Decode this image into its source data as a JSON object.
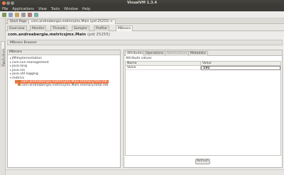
{
  "window": {
    "title": "VisualVM 1.3.4"
  },
  "menu": [
    "File",
    "Applications",
    "View",
    "Tools",
    "Window",
    "Help"
  ],
  "left_strip": {
    "tab_label": "Applications"
  },
  "document_tabs": [
    {
      "label": "Start Page"
    },
    {
      "label": "com.andreabergia.metricsjmx.Main (pid 25255)"
    }
  ],
  "sub_tabs": [
    {
      "label": "Overview"
    },
    {
      "label": "Monitor"
    },
    {
      "label": "Threads"
    },
    {
      "label": "Sampler"
    },
    {
      "label": "Profiler"
    },
    {
      "label": "MBeans"
    }
  ],
  "heading": {
    "main": "com.andreabergia.metricsjmx.Main",
    "pid": "(pid 25255)"
  },
  "section_title": "MBeans Browser",
  "tree": {
    "header": "MBeans",
    "items": [
      {
        "label": "JMImplementation",
        "indent": 0,
        "expander": "▸"
      },
      {
        "label": "com.sun.management",
        "indent": 0,
        "expander": "▸"
      },
      {
        "label": "java.lang",
        "indent": 0,
        "expander": "▸"
      },
      {
        "label": "java.nio",
        "indent": 0,
        "expander": "▸"
      },
      {
        "label": "java.util.logging",
        "indent": 0,
        "expander": "▸"
      },
      {
        "label": "metrics",
        "indent": 0,
        "expander": "▾"
      },
      {
        "label": "com.andreabergia.metricsjmx.Main.memory.free.mb",
        "indent": 1,
        "expander": "",
        "selected": true
      },
      {
        "label": "com.andreabergia.metricsjmx.Main.memory.total.mb",
        "indent": 1,
        "expander": ""
      }
    ]
  },
  "detail_tabs": [
    {
      "label": "Attributes",
      "state": "active"
    },
    {
      "label": "Operations",
      "state": "normal"
    },
    {
      "label": "Notifications",
      "state": "disabled"
    },
    {
      "label": "Metadata",
      "state": "normal"
    }
  ],
  "attributes": {
    "caption": "Attribute values",
    "columns": [
      "Name",
      "Value"
    ],
    "rows": [
      {
        "name": "Value",
        "value": "192"
      }
    ]
  },
  "refresh_label": "Refresh",
  "colors": {
    "selection": "#f07746",
    "titlebar": "#3c3b37",
    "close_button": "#f0794d"
  }
}
